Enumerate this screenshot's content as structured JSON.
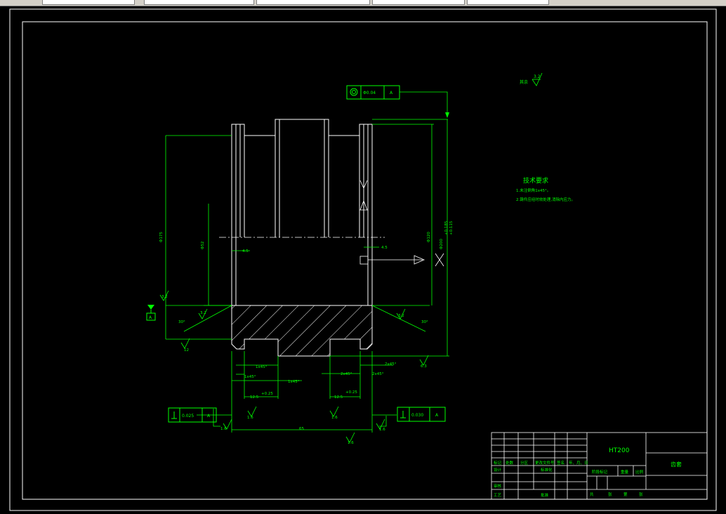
{
  "colors": {
    "background": "#000000",
    "frame": "#ffffff",
    "geometry": "#ffffff",
    "dimension": "#00ff00",
    "hatch": "#ffffff",
    "centerline": "#ffffff"
  },
  "taskbar": {
    "tabs": [
      "",
      "",
      "",
      "",
      ""
    ]
  },
  "roughness": {
    "general": "3.2",
    "general_note_prefix": "其余"
  },
  "tolerance_frames": {
    "top": {
      "symbol": "concentricity-icon",
      "value": "Φ0.04",
      "datum": "A"
    },
    "left": {
      "symbol": "perpendicularity-icon",
      "value": "0.025",
      "datum": "A"
    },
    "right": {
      "symbol": "perpendicularity-icon",
      "value": "0.030",
      "datum": "A"
    }
  },
  "datum_label": "A",
  "tech_requirements": {
    "title": "技术要求",
    "items": [
      "1.未注倒角1x45°。",
      "2.铸件应经时效处理,消除内应力。"
    ]
  },
  "dimensions": {
    "dia_175": "Φ175",
    "dia_small": "Φ52",
    "dia_120": "Φ120",
    "dia_bore": "Φ200",
    "tol_upper": "+0.185",
    "tol_lower": "+0.115",
    "width_4_5_left": "4.5",
    "width_4_5_right": "4.5",
    "chamfer_left": "1x45°",
    "chamfer_left2": "1x45°",
    "chamfer_left3": "1x45°",
    "chamfer_right": "2x45°",
    "chamfer_right2": "2x45°",
    "chamfer_right3": "2x45°",
    "groove_left": "12.5",
    "groove_left_tol": "+0.25",
    "groove_right": "12.5",
    "groove_right_tol": "+0.25",
    "overall_width": "65",
    "angle_left_outer": "30°",
    "angle_left_inner": "3.2",
    "angle_right_outer": "30°",
    "angle_right_inner": "3.2",
    "rough_left_bottom": "12",
    "rough_right_bottom": "6.3",
    "rough_left_small": "3.2",
    "rough_center_bottom": "1.6",
    "rough_left_groove": "1.6",
    "rough_right_groove": "1.6",
    "rough_left_side": "1.6",
    "rough_right_side": "1.6",
    "rough_bore": "3.2"
  },
  "title_block": {
    "material": "HT200",
    "part_name": "齿套",
    "col_labels": [
      "标记",
      "处数",
      "分区",
      "更改文件号",
      "签名",
      "年、月、日"
    ],
    "design_label": "设计",
    "standardize_label": "标准化",
    "stage_label": "阶段标记",
    "weight_label": "重量",
    "scale_label": "比例",
    "review_label": "审核",
    "process_label": "工艺",
    "approve_label": "批准",
    "sheet_total": "共",
    "sheet_label": "张",
    "sheet_no": "第",
    "sheet_label2": "张"
  }
}
